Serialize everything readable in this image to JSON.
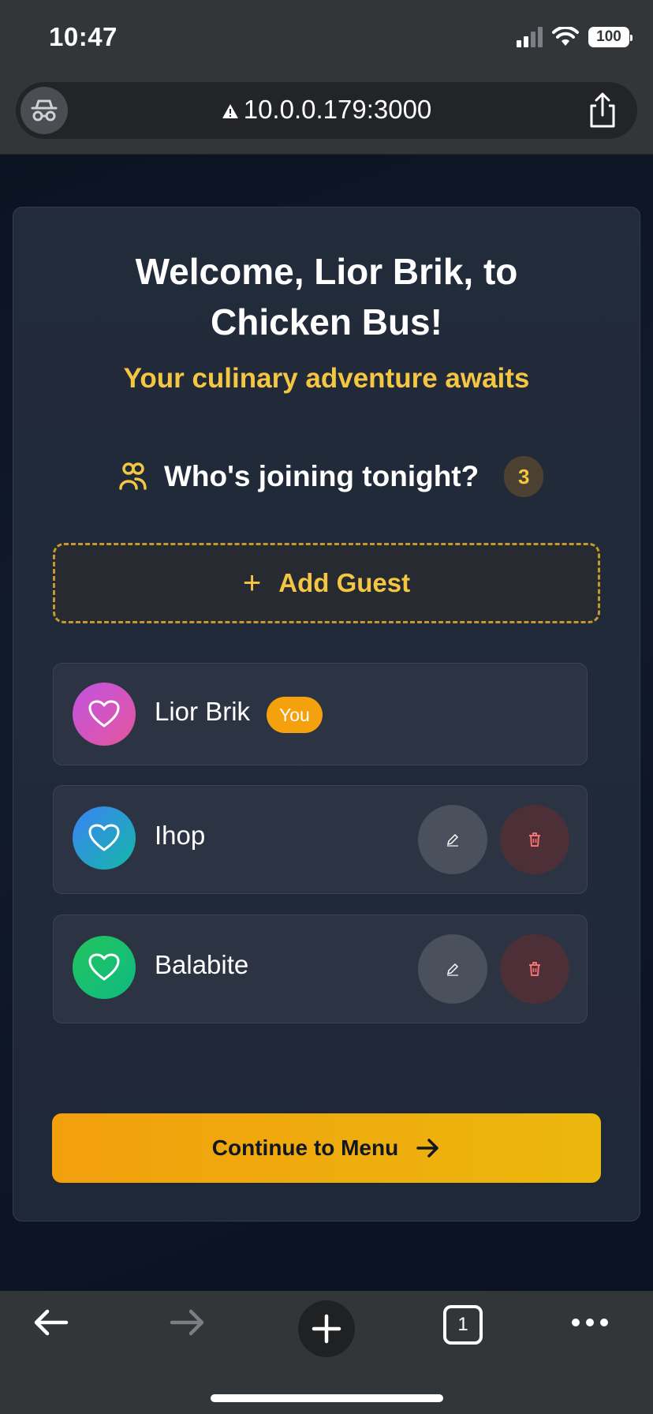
{
  "status_bar": {
    "time": "10:47",
    "battery": "100"
  },
  "browser": {
    "url": "10.0.0.179:3000"
  },
  "hero": {
    "welcome_line1": "Welcome, Lior Brik, to",
    "welcome_line2": "Chicken Bus!",
    "tagline": "Your culinary adventure awaits"
  },
  "guests_section": {
    "title": "Who's joining tonight?",
    "count": "3",
    "add_label": "Add Guest"
  },
  "guests": [
    {
      "name": "Lior Brik",
      "badge": "You",
      "avatar_gradient": [
        "#c153e0",
        "#e4569e"
      ]
    },
    {
      "name": "Ihop",
      "avatar_gradient": [
        "#3b82f6",
        "#14b8a6"
      ]
    },
    {
      "name": "Balabite",
      "avatar_gradient": [
        "#22c55e",
        "#10b981"
      ]
    }
  ],
  "actions": {
    "continue_label": "Continue to Menu"
  },
  "tab_count": "1",
  "colors": {
    "accent": "#f4c642",
    "button": "#f29f0d",
    "delete": "#f87171"
  }
}
